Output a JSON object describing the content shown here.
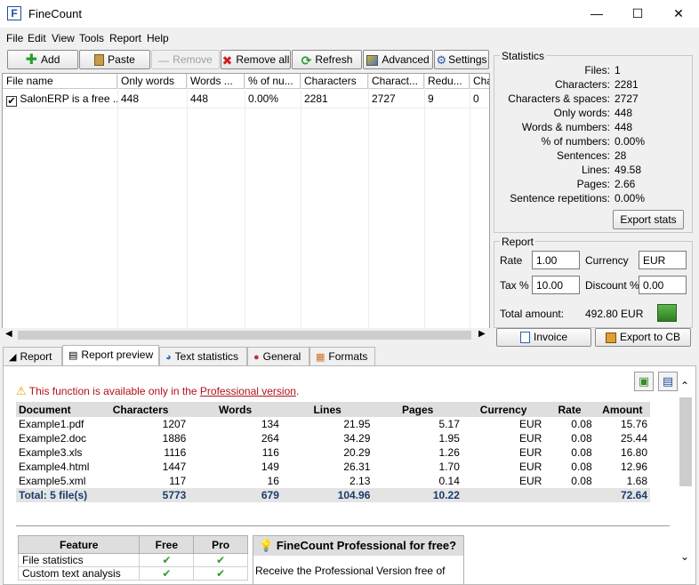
{
  "window": {
    "title": "FineCount",
    "icon": "finecount-app-icon",
    "minimize": "—",
    "maximize": "☐",
    "close": "✕"
  },
  "menu": [
    "File",
    "Edit",
    "View",
    "Tools",
    "Report",
    "Help"
  ],
  "toolbar": {
    "add": "Add",
    "paste": "Paste",
    "remove": "Remove",
    "remove_all": "Remove all",
    "refresh": "Refresh",
    "advanced": "Advanced",
    "settings": "Settings"
  },
  "grid": {
    "columns": [
      "File name",
      "Only words",
      "Words ...",
      "% of nu...",
      "Characters",
      "Charact...",
      "Redu...",
      "Cha"
    ],
    "rows": [
      {
        "checked": true,
        "cells": [
          "SalonERP is a free ...",
          "448",
          "448",
          "0.00%",
          "2281",
          "2727",
          "9",
          "0"
        ]
      }
    ]
  },
  "statistics": {
    "title": "Statistics",
    "items": [
      {
        "label": "Files:",
        "value": "1"
      },
      {
        "label": "Characters:",
        "value": "2281"
      },
      {
        "label": "Characters & spaces:",
        "value": "2727"
      },
      {
        "label": "Only words:",
        "value": "448"
      },
      {
        "label": "Words & numbers:",
        "value": "448"
      },
      {
        "label": "% of numbers:",
        "value": "0.00%"
      },
      {
        "label": "Sentences:",
        "value": "28"
      },
      {
        "label": "Lines:",
        "value": "49.58"
      },
      {
        "label": "Pages:",
        "value": "2.66"
      },
      {
        "label": "Sentence repetitions:",
        "value": "0.00%"
      }
    ],
    "export_button": "Export stats"
  },
  "report": {
    "title": "Report",
    "rate_label": "Rate",
    "rate": "1.00",
    "currency_label": "Currency",
    "currency": "EUR",
    "tax_label": "Tax %",
    "tax": "10.00",
    "discount_label": "Discount %",
    "discount": "0.00",
    "total_label": "Total amount:",
    "total_value": "492.80 EUR",
    "invoice_button": "Invoice",
    "export_cb_button": "Export to CB"
  },
  "tabs": [
    "Report",
    "Report preview",
    "Text statistics",
    "General",
    "Formats"
  ],
  "preview": {
    "warning_text": "This function is available only in the ",
    "warning_link": "Professional version",
    "warning_end": ".",
    "table": {
      "headers": [
        "Document",
        "Characters",
        "Words",
        "Lines",
        "Pages",
        "Currency",
        "Rate",
        "Amount"
      ],
      "rows": [
        [
          "Example1.pdf",
          "1207",
          "134",
          "21.95",
          "5.17",
          "EUR",
          "0.08",
          "15.76"
        ],
        [
          "Example2.doc",
          "1886",
          "264",
          "34.29",
          "1.95",
          "EUR",
          "0.08",
          "25.44"
        ],
        [
          "Example3.xls",
          "1116",
          "116",
          "20.29",
          "1.26",
          "EUR",
          "0.08",
          "16.80"
        ],
        [
          "Example4.html",
          "1447",
          "149",
          "26.31",
          "1.70",
          "EUR",
          "0.08",
          "12.96"
        ],
        [
          "Example5.xml",
          "117",
          "16",
          "2.13",
          "0.14",
          "EUR",
          "0.08",
          "1.68"
        ]
      ],
      "total": [
        "Total: 5 file(s)",
        "5773",
        "679",
        "104.96",
        "10.22",
        "",
        "",
        "72.64"
      ]
    },
    "features": {
      "headers": [
        "Feature",
        "Free",
        "Pro"
      ],
      "rows": [
        {
          "name": "File statistics",
          "free": "✔",
          "pro": "✔"
        },
        {
          "name": "Custom text analysis",
          "free": "✔",
          "pro": "✔"
        }
      ]
    },
    "promo_title": "FineCount Professional for free?",
    "promo_text": "Receive the Professional Version free of"
  },
  "colors": {
    "warning_red": "#b0121a",
    "link": "#b0121a",
    "check_green": "#2e9e2e",
    "total_text": "#1a3c6e"
  }
}
